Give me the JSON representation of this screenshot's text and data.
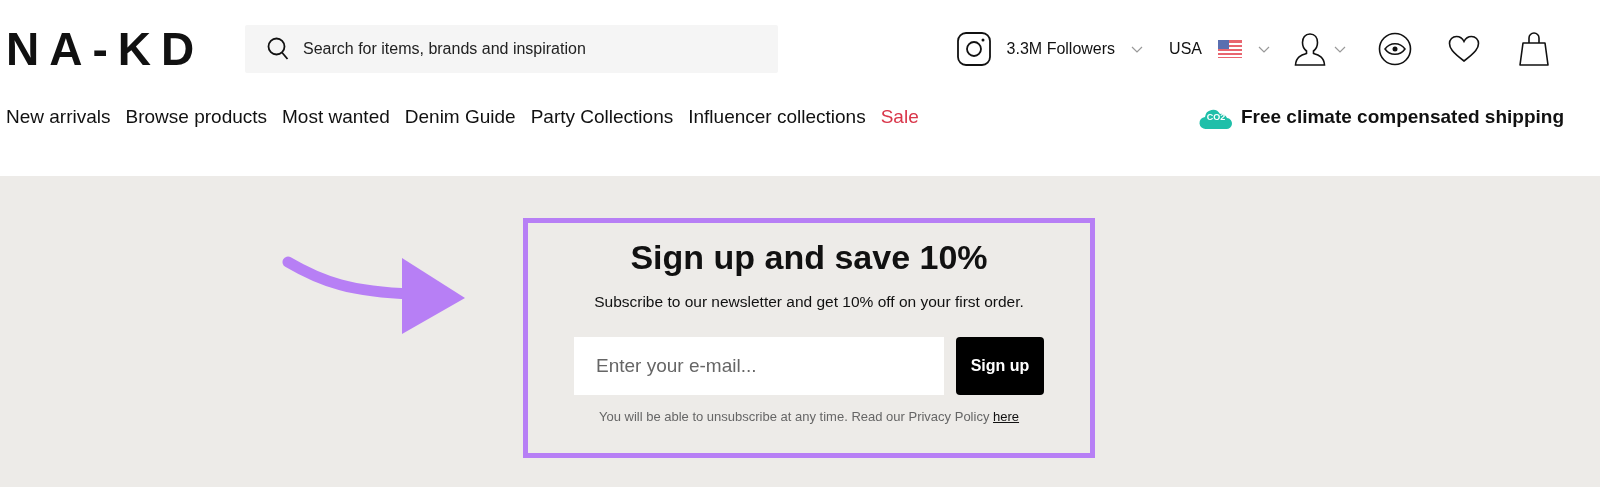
{
  "logo": "NA-KD",
  "search": {
    "placeholder": "Search for items, brands and inspiration"
  },
  "header_actions": {
    "followers": "3.3M Followers",
    "country": "USA"
  },
  "nav": [
    {
      "label": "New arrivals",
      "highlighted": false
    },
    {
      "label": "Browse products",
      "highlighted": false
    },
    {
      "label": "Most wanted",
      "highlighted": false
    },
    {
      "label": "Denim Guide",
      "highlighted": false
    },
    {
      "label": "Party Collections",
      "highlighted": false
    },
    {
      "label": "Influencer collections",
      "highlighted": false
    },
    {
      "label": "Sale",
      "highlighted": true
    }
  ],
  "shipping": {
    "badge": "CO2",
    "text": "Free climate compensated shipping"
  },
  "newsletter": {
    "title": "Sign up and save 10%",
    "subtitle": "Subscribe to our newsletter and get 10% off on your first order.",
    "email": {
      "placeholder": "Enter your e-mail..."
    },
    "button": "Sign up",
    "note": "You will be able to unsubscribe at any time. Read our Privacy Policy",
    "link": "here"
  }
}
